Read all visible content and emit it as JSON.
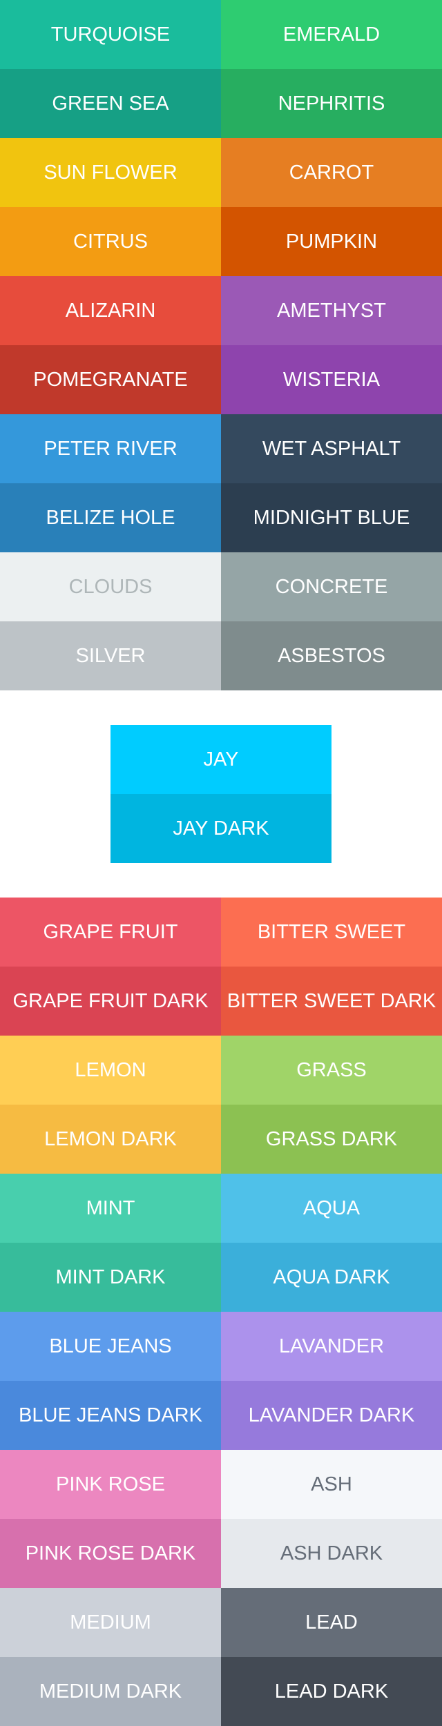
{
  "top_swatches": [
    {
      "name": "TURQUOISE",
      "color": "#1ABC9C",
      "text_color": "#FFFFFF"
    },
    {
      "name": "EMERALD",
      "color": "#2ECC71",
      "text_color": "#FFFFFF"
    },
    {
      "name": "GREEN SEA",
      "color": "#16A085",
      "text_color": "#FFFFFF"
    },
    {
      "name": "NEPHRITIS",
      "color": "#27AE60",
      "text_color": "#FFFFFF"
    },
    {
      "name": "SUN FLOWER",
      "color": "#F1C40F",
      "text_color": "#FFFFFF"
    },
    {
      "name": "CARROT",
      "color": "#E67E22",
      "text_color": "#FFFFFF"
    },
    {
      "name": "CITRUS",
      "color": "#F39C12",
      "text_color": "#FFFFFF"
    },
    {
      "name": "PUMPKIN",
      "color": "#D35400",
      "text_color": "#FFFFFF"
    },
    {
      "name": "ALIZARIN",
      "color": "#E74C3C",
      "text_color": "#FFFFFF"
    },
    {
      "name": "AMETHYST",
      "color": "#9B59B6",
      "text_color": "#FFFFFF"
    },
    {
      "name": "POMEGRANATE",
      "color": "#C0392B",
      "text_color": "#FFFFFF"
    },
    {
      "name": "WISTERIA",
      "color": "#8E44AD",
      "text_color": "#FFFFFF"
    },
    {
      "name": "PETER RIVER",
      "color": "#3498DB",
      "text_color": "#FFFFFF"
    },
    {
      "name": "WET ASPHALT",
      "color": "#34495E",
      "text_color": "#FFFFFF"
    },
    {
      "name": "BELIZE HOLE",
      "color": "#2980B9",
      "text_color": "#FFFFFF"
    },
    {
      "name": "MIDNIGHT BLUE",
      "color": "#2C3E50",
      "text_color": "#FFFFFF"
    },
    {
      "name": "CLOUDS",
      "color": "#ECF0F1",
      "text_color": "#AEB6B8"
    },
    {
      "name": "CONCRETE",
      "color": "#95A5A6",
      "text_color": "#FFFFFF"
    },
    {
      "name": "SILVER",
      "color": "#BDC3C7",
      "text_color": "#FFFFFF"
    },
    {
      "name": "ASBESTOS",
      "color": "#7F8C8D",
      "text_color": "#FFFFFF"
    }
  ],
  "jay_swatches": [
    {
      "name": "JAY",
      "color": "#00CCFF",
      "text_color": "#FFFFFF"
    },
    {
      "name": "JAY DARK",
      "color": "#00B5E0",
      "text_color": "#FFFFFF"
    }
  ],
  "bottom_swatches": [
    {
      "name": "GRAPE FRUIT",
      "color": "#ED5565",
      "text_color": "#FFFFFF"
    },
    {
      "name": "BITTER SWEET",
      "color": "#FC6E51",
      "text_color": "#FFFFFF"
    },
    {
      "name": "GRAPE FRUIT DARK",
      "color": "#DA4453",
      "text_color": "#FFFFFF"
    },
    {
      "name": "BITTER SWEET DARK",
      "color": "#E9573F",
      "text_color": "#FFFFFF"
    },
    {
      "name": "LEMON",
      "color": "#FFCE54",
      "text_color": "#FFFFFF"
    },
    {
      "name": "GRASS",
      "color": "#A0D468",
      "text_color": "#FFFFFF"
    },
    {
      "name": "LEMON DARK",
      "color": "#F6BB42",
      "text_color": "#FFFFFF"
    },
    {
      "name": "GRASS DARK",
      "color": "#8CC152",
      "text_color": "#FFFFFF"
    },
    {
      "name": "MINT",
      "color": "#48CFAD",
      "text_color": "#FFFFFF"
    },
    {
      "name": "AQUA",
      "color": "#4FC1E9",
      "text_color": "#FFFFFF"
    },
    {
      "name": "MINT DARK",
      "color": "#37BC9B",
      "text_color": "#FFFFFF"
    },
    {
      "name": "AQUA DARK",
      "color": "#3BAFDA",
      "text_color": "#FFFFFF"
    },
    {
      "name": "BLUE JEANS",
      "color": "#5D9CEC",
      "text_color": "#FFFFFF"
    },
    {
      "name": "LAVANDER",
      "color": "#AC92EC",
      "text_color": "#FFFFFF"
    },
    {
      "name": "BLUE JEANS DARK",
      "color": "#4A89DC",
      "text_color": "#FFFFFF"
    },
    {
      "name": "LAVANDER DARK",
      "color": "#967ADC",
      "text_color": "#FFFFFF"
    },
    {
      "name": "PINK ROSE",
      "color": "#EC87C0",
      "text_color": "#FFFFFF"
    },
    {
      "name": "ASH",
      "color": "#F5F7FA",
      "text_color": "#656D78"
    },
    {
      "name": "PINK ROSE DARK",
      "color": "#D770AD",
      "text_color": "#FFFFFF"
    },
    {
      "name": "ASH DARK",
      "color": "#E6E9ED",
      "text_color": "#656D78"
    },
    {
      "name": "MEDIUM",
      "color": "#CCD1D9",
      "text_color": "#FFFFFF"
    },
    {
      "name": "LEAD",
      "color": "#656D78",
      "text_color": "#FFFFFF"
    },
    {
      "name": "MEDIUM DARK",
      "color": "#AAB2BD",
      "text_color": "#FFFFFF"
    },
    {
      "name": "LEAD DARK",
      "color": "#434A54",
      "text_color": "#FFFFFF"
    }
  ]
}
